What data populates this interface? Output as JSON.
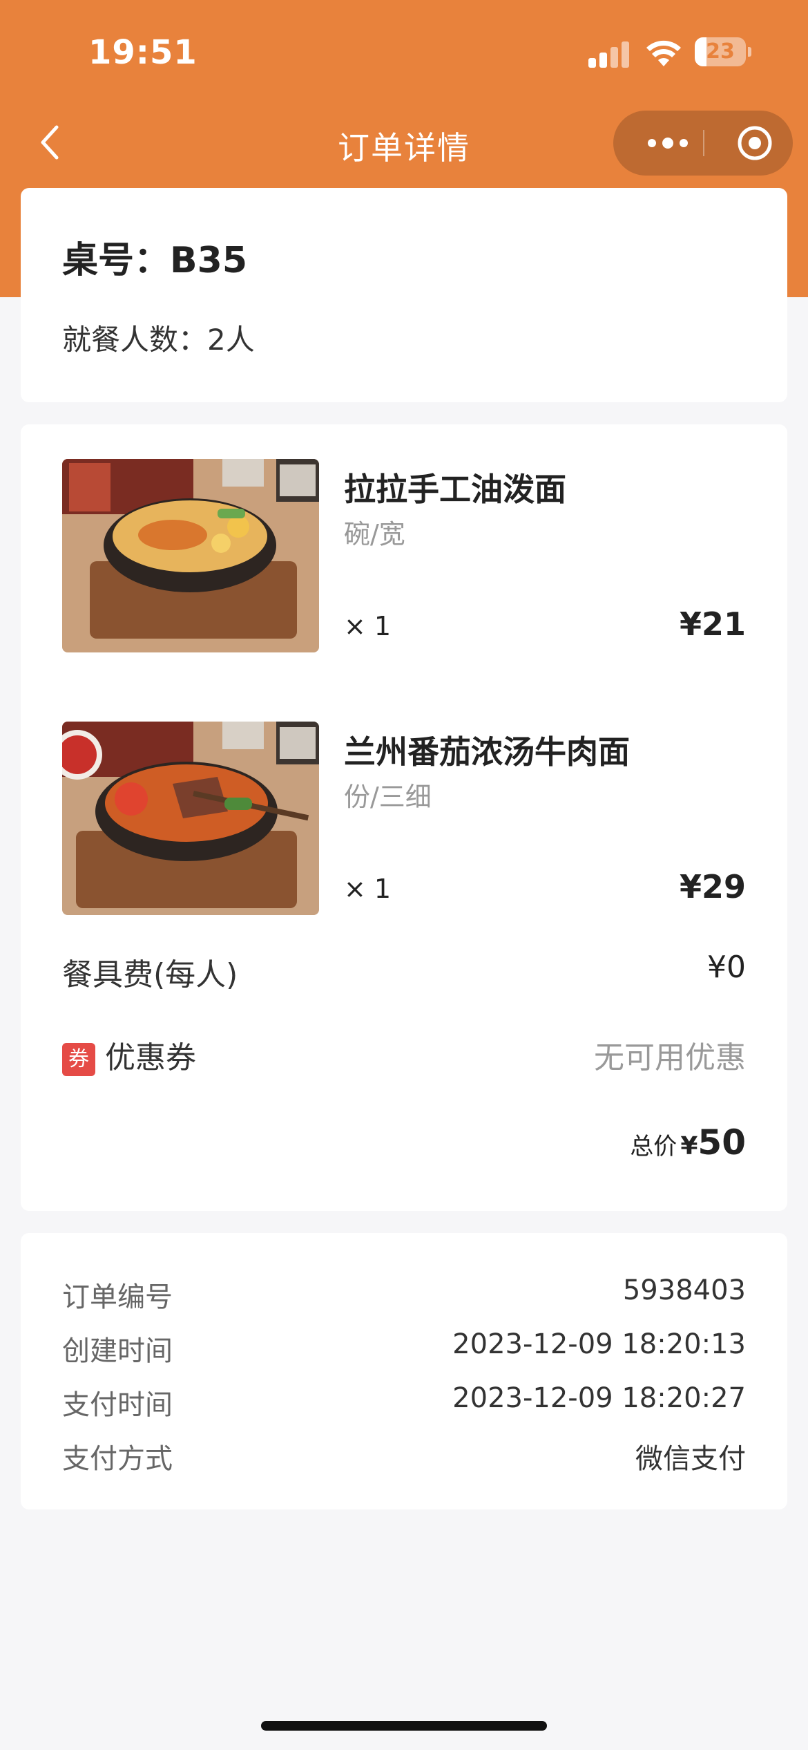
{
  "status_bar": {
    "time": "19:51",
    "battery": "23"
  },
  "nav": {
    "title": "订单详情",
    "accent_color": "#e8823c"
  },
  "table": {
    "number": "桌号：B35",
    "diners": "就餐人数：2人"
  },
  "items": [
    {
      "name": "拉拉手工油泼面",
      "spec": "碗/宽",
      "qty": "× 1",
      "price": "¥21"
    },
    {
      "name": "兰州番茄浓汤牛肉面",
      "spec": "份/三细",
      "qty": "× 1",
      "price": "¥29"
    }
  ],
  "tableware": {
    "label": "餐具费(每人)",
    "value": "¥0"
  },
  "coupon": {
    "badge": "券",
    "label": "优惠券",
    "value": "无可用优惠"
  },
  "total": {
    "label": "总价",
    "currency": "¥",
    "amount": "50"
  },
  "order_info": [
    {
      "label": "订单编号",
      "value": "5938403"
    },
    {
      "label": "创建时间",
      "value": "2023-12-09 18:20:13"
    },
    {
      "label": "支付时间",
      "value": "2023-12-09 18:20:27"
    },
    {
      "label": "支付方式",
      "value": "微信支付"
    }
  ]
}
